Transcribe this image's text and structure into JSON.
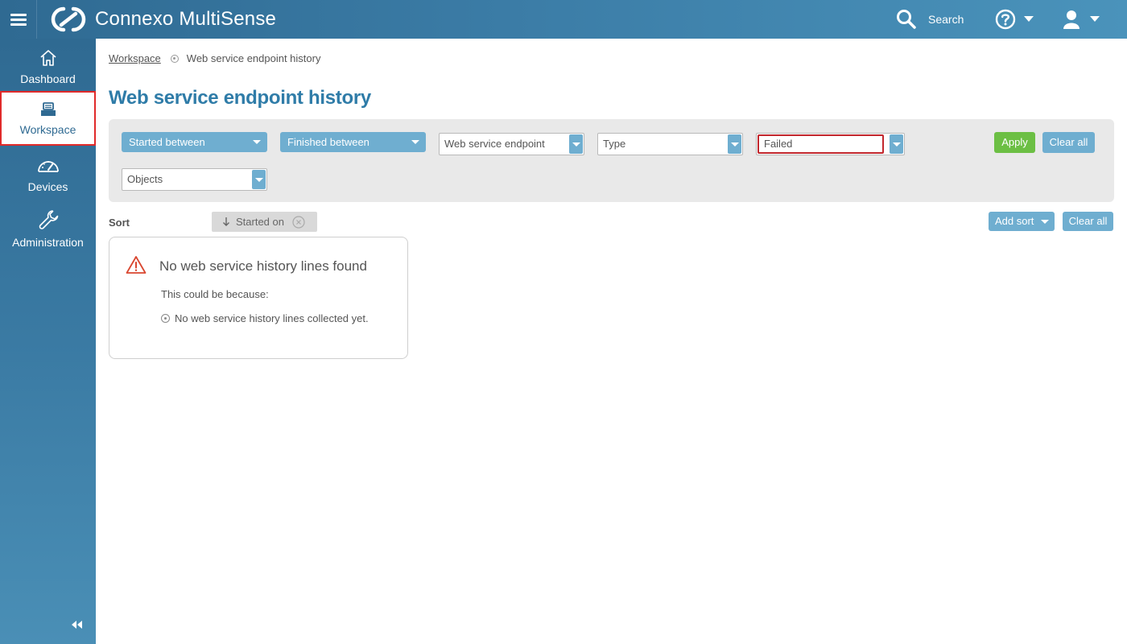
{
  "header": {
    "app_title": "Connexo MultiSense",
    "search_label": "Search",
    "icons": [
      "hamburger-menu-icon",
      "connexo-logo",
      "search-icon",
      "help-icon",
      "user-icon"
    ]
  },
  "sidebar": {
    "items": [
      {
        "label": "Dashboard",
        "icon": "home-icon",
        "active": false
      },
      {
        "label": "Workspace",
        "icon": "workspace-icon",
        "active": true
      },
      {
        "label": "Devices",
        "icon": "gauge-icon",
        "active": false
      },
      {
        "label": "Administration",
        "icon": "wrench-icon",
        "active": false
      }
    ]
  },
  "breadcrumb": {
    "link": "Workspace",
    "current": "Web service endpoint history"
  },
  "page_title": "Web service endpoint history",
  "filters": {
    "started_between": "Started between",
    "finished_between": "Finished between",
    "web_service_endpoint": "Web service endpoint",
    "type": "Type",
    "status": "Failed",
    "objects": "Objects",
    "apply_label": "Apply",
    "clear_all_label": "Clear all"
  },
  "sort": {
    "label": "Sort",
    "chip": "Started on",
    "add_sort_label": "Add sort",
    "clear_all_label": "Clear all"
  },
  "empty_state": {
    "title": "No web service history lines found",
    "subtitle": "This could be because:",
    "reason": "No web service history lines collected yet."
  },
  "colors": {
    "header": "#3b7ca6",
    "accent": "#6faed0",
    "apply": "#6cbf44",
    "title": "#2f7ca8",
    "focus_border": "#c2272d"
  }
}
